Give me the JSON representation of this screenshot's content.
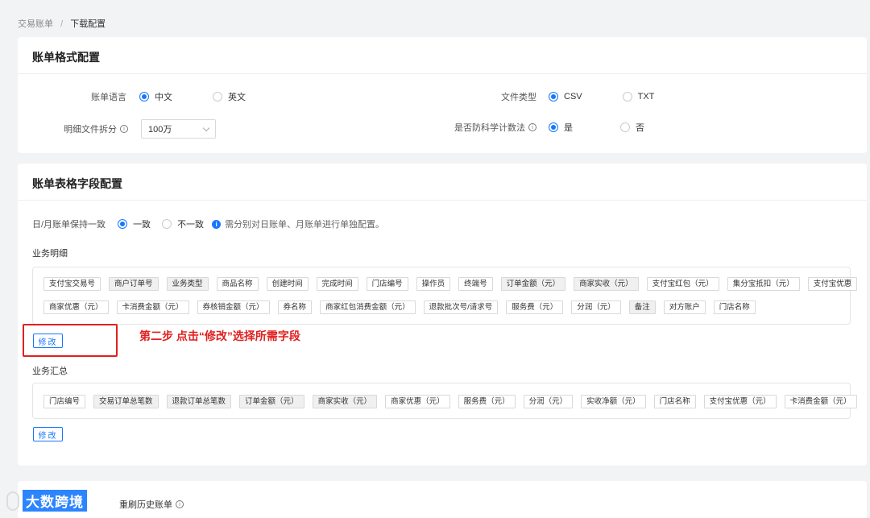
{
  "breadcrumb": {
    "parent": "交易账单",
    "separator": "/",
    "current": "下载配置"
  },
  "format_card": {
    "title": "账单格式配置",
    "language": {
      "label": "账单语言",
      "options": [
        "中文",
        "英文"
      ],
      "selected": "中文"
    },
    "file_type": {
      "label": "文件类型",
      "options": [
        "CSV",
        "TXT"
      ],
      "selected": "CSV"
    },
    "split": {
      "label": "明细文件拆分",
      "value": "100万"
    },
    "anti_sci": {
      "label": "是否防科学计数法",
      "options": [
        "是",
        "否"
      ],
      "selected": "是"
    }
  },
  "fields_card": {
    "title": "账单表格字段配置",
    "consistency": {
      "label": "日/月账单保持一致",
      "options": [
        "一致",
        "不一致"
      ],
      "selected": "一致",
      "hint": "需分别对日账单、月账单进行单独配置。"
    },
    "detail": {
      "label": "业务明细",
      "row1": [
        "支付宝交易号",
        "商户订单号",
        "业务类型",
        "商品名称",
        "创建时间",
        "完成时间",
        "门店编号",
        "操作员",
        "终端号",
        "订单金额（元）",
        "商家实收（元）",
        "支付宝红包（元）",
        "集分宝抵扣（元）",
        "支付宝优惠"
      ],
      "row2": [
        "商家优惠（元）",
        "卡消费金额（元）",
        "券核销金额（元）",
        "券名称",
        "商家红包消费金额（元）",
        "退款批次号/请求号",
        "服务费（元）",
        "分润（元）",
        "备注",
        "对方账户",
        "门店名称"
      ],
      "edit_label": "修改"
    },
    "summary": {
      "label": "业务汇总",
      "row1": [
        "门店编号",
        "交易订单总笔数",
        "退款订单总笔数",
        "订单金额（元）",
        "商家实收（元）",
        "商家优惠（元）",
        "服务费（元）",
        "分润（元）",
        "实收净额（元）",
        "门店名称",
        "支付宝优惠（元）",
        "卡消费金额（元）"
      ],
      "edit_label": "修改"
    }
  },
  "annotation": "第二步  点击“修改”选择所需字段",
  "watermark": "大数跨境",
  "footer": {
    "link_text": "重刷历史账单"
  },
  "colors": {
    "accent": "#1677ff",
    "annotation": "#e02020"
  }
}
